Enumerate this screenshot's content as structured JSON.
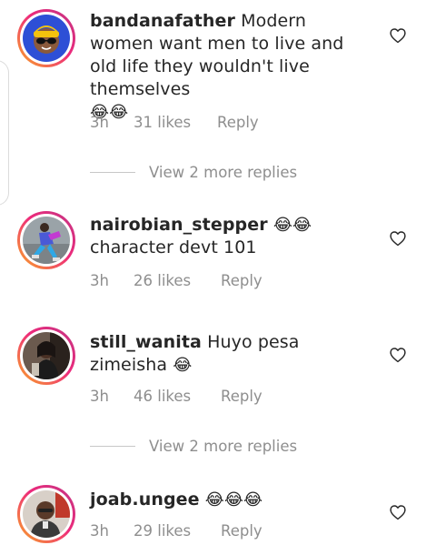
{
  "comments": [
    {
      "username": "bandanafather",
      "text": "Modern women want men to live and old life they wouldn't live themselves",
      "emojis": "😂😂",
      "time": "3h",
      "likes": "31 likes",
      "reply": "Reply",
      "avatar": "cartoon-avatar"
    },
    {
      "username": "nairobian_stepper",
      "text": "character devt 101",
      "emojis": "😂😂",
      "time": "3h",
      "likes": "26 likes",
      "reply": "Reply",
      "avatar": "dancer-photo"
    },
    {
      "username": "still_wanita",
      "text": "Huyo pesa zimeisha",
      "emojis": "😂",
      "time": "3h",
      "likes": "46 likes",
      "reply": "Reply",
      "avatar": "portrait-photo"
    },
    {
      "username": "joab.ungee",
      "text": "",
      "emojis": "😂😂😂",
      "time": "3h",
      "likes": "29 likes",
      "reply": "Reply",
      "avatar": "man-photo"
    }
  ],
  "view_more": [
    {
      "label": "View 2 more replies"
    },
    {
      "label": "View 2 more replies"
    }
  ],
  "colors": {
    "text": "#262626",
    "meta": "#8e8e8e",
    "ring_start": "#f9a825",
    "ring_end": "#c13584"
  },
  "icons": {
    "like": "heart-outline-icon"
  }
}
